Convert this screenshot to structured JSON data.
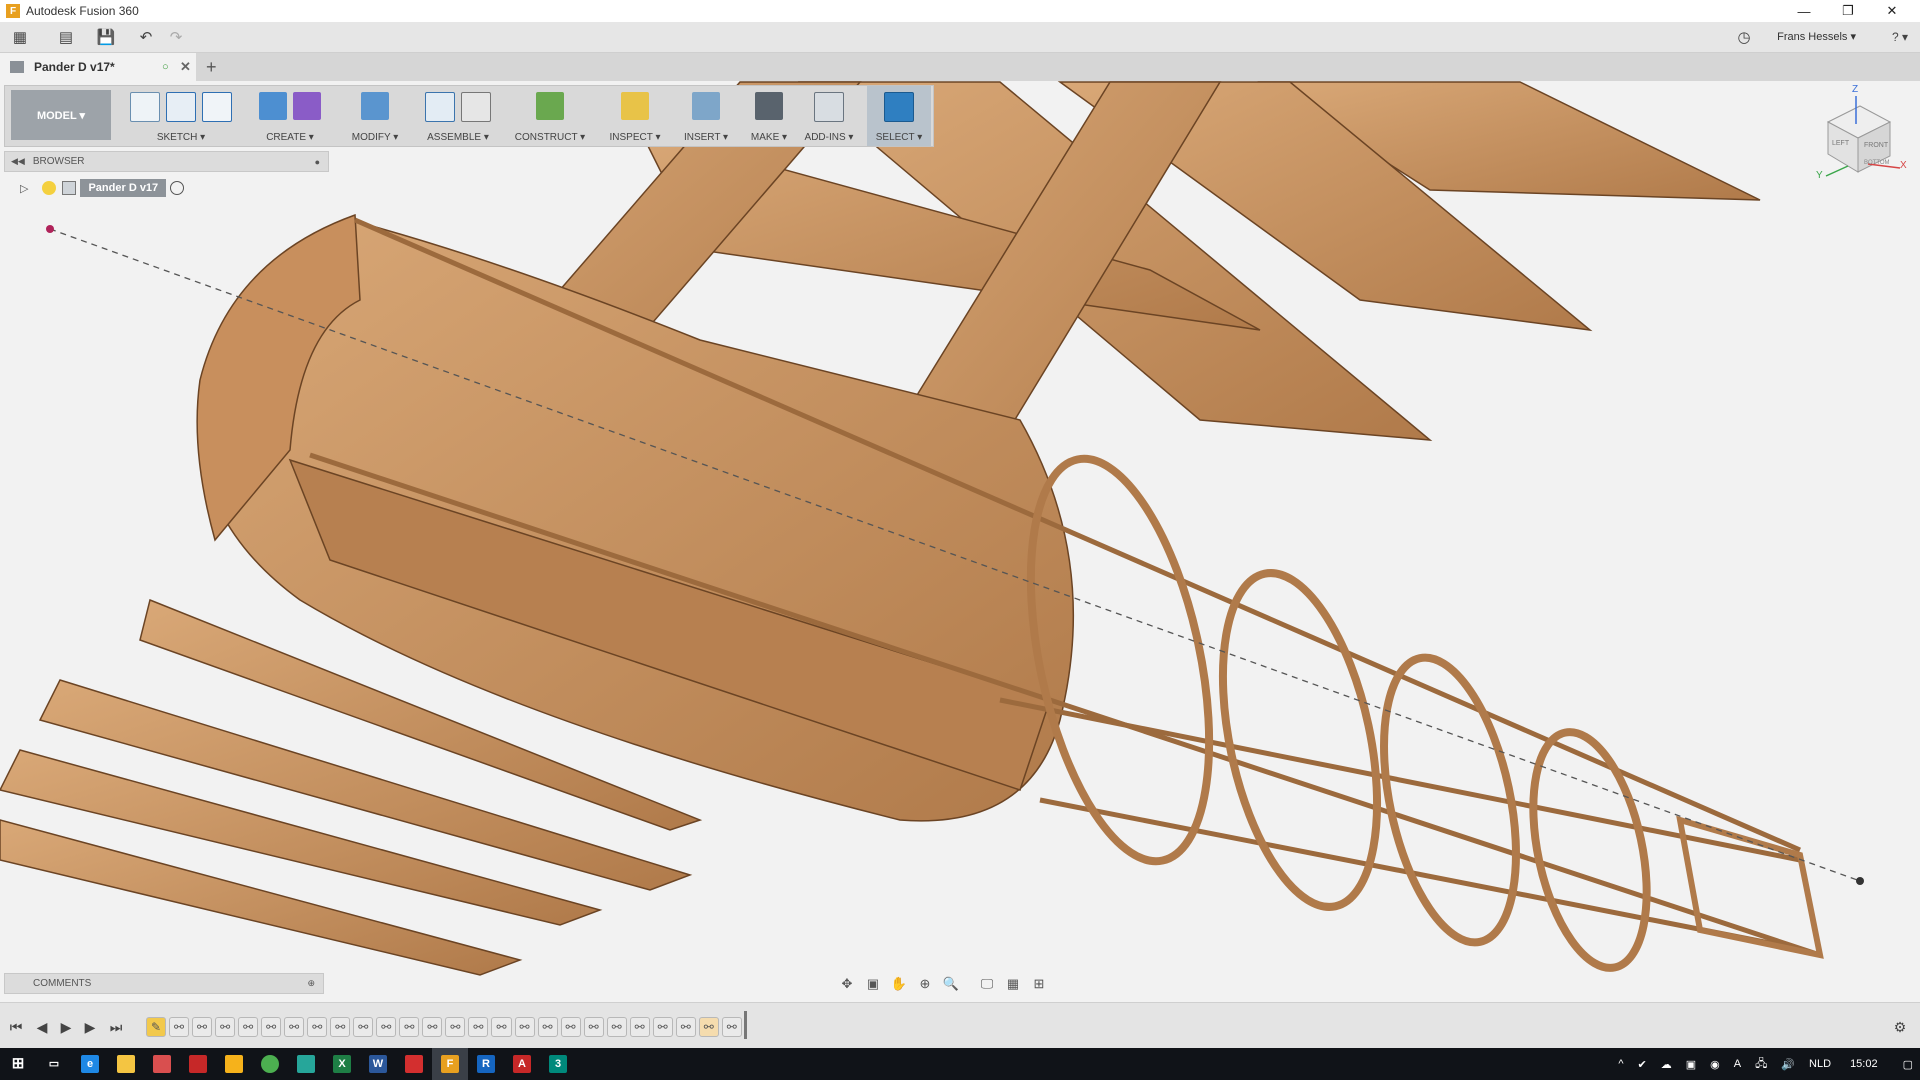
{
  "window": {
    "title": "Autodesk Fusion 360",
    "controls": [
      "—",
      "❐",
      "✕"
    ]
  },
  "appbar": {
    "user": "Frans Hessels ▾",
    "help": "? ▾"
  },
  "document_tab": {
    "name": "Pander D v17*",
    "add": "+"
  },
  "toolbar": {
    "workspace": "MODEL ▾",
    "groups": [
      {
        "label": "SKETCH ▾"
      },
      {
        "label": "CREATE ▾"
      },
      {
        "label": "MODIFY ▾"
      },
      {
        "label": "ASSEMBLE ▾"
      },
      {
        "label": "CONSTRUCT ▾"
      },
      {
        "label": "INSPECT ▾"
      },
      {
        "label": "INSERT ▾"
      },
      {
        "label": "MAKE ▾"
      },
      {
        "label": "ADD-INS ▾"
      },
      {
        "label": "SELECT ▾"
      }
    ]
  },
  "viewcube": {
    "top": "Z",
    "front": "FRONT",
    "left": "LEFT",
    "bottom": "BOTTOM",
    "x": "X",
    "y": "Y"
  },
  "browser": {
    "title": "BROWSER",
    "root": "Pander D v17"
  },
  "comments": {
    "title": "COMMENTS"
  },
  "taskbar": {
    "language": "NLD",
    "time": "15:02"
  },
  "colors": {
    "wood": "#c79463",
    "wood_dark": "#8a5b33",
    "accent": "#0696d7"
  }
}
